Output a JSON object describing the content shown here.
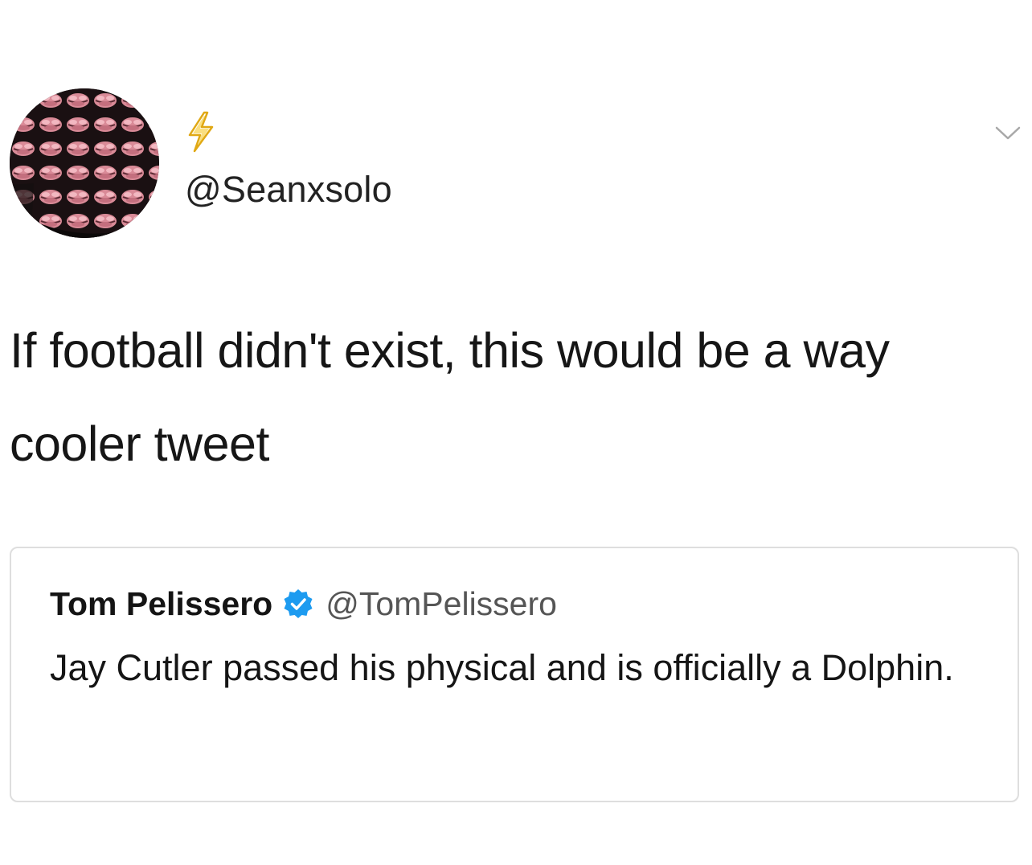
{
  "tweet": {
    "handle": "@Seanxsolo",
    "name_emoji": "lightning-bolt",
    "text": "If football didn't exist, this would be a way cooler tweet"
  },
  "quoted_tweet": {
    "name": "Tom Pelissero",
    "verified": true,
    "handle": "@TomPelissero",
    "text": "Jay Cutler passed his physical and is officially a Dolphin."
  },
  "colors": {
    "verified_blue": "#1d9bf0",
    "emoji_yellow": "#f5c518",
    "card_border": "#dedede"
  }
}
